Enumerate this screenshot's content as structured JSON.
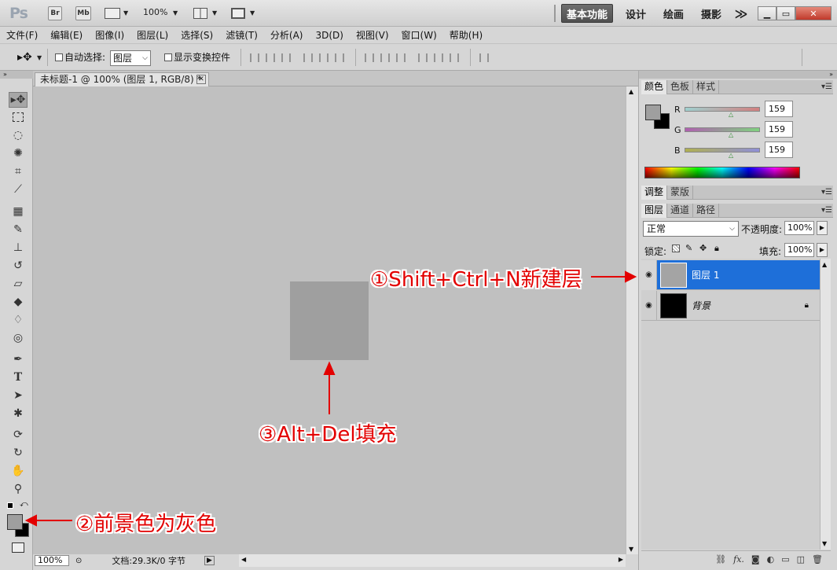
{
  "app": {
    "logo": "Ps",
    "bridge_btn": "Br",
    "minibridge_btn": "Mb",
    "zoom": "100%",
    "workspaces": [
      "基本功能",
      "设计",
      "绘画",
      "摄影"
    ],
    "more_workspaces": "≫"
  },
  "menu": [
    "文件(F)",
    "编辑(E)",
    "图像(I)",
    "图层(L)",
    "选择(S)",
    "滤镜(T)",
    "分析(A)",
    "3D(D)",
    "视图(V)",
    "窗口(W)",
    "帮助(H)"
  ],
  "options": {
    "auto_select_label": "自动选择:",
    "auto_select_value": "图层",
    "show_transform_label": "显示变换控件"
  },
  "document": {
    "tab_title": "未标题-1 @ 100% (图层 1, RGB/8) *",
    "status_zoom": "100%",
    "status_doc": "文档:29.3K/0 字节"
  },
  "color_panel": {
    "tabs": [
      "颜色",
      "色板",
      "样式"
    ],
    "channels": [
      {
        "label": "R",
        "value": "159",
        "track": "#d27f7f"
      },
      {
        "label": "G",
        "value": "159",
        "track": "#7fd27f"
      },
      {
        "label": "B",
        "value": "159",
        "track": "#8f8fd8"
      }
    ],
    "fg_color": "#9f9f9f",
    "bg_color": "#000000"
  },
  "adjust_panel": {
    "tabs": [
      "调整",
      "蒙版"
    ]
  },
  "layers_panel": {
    "tabs": [
      "图层",
      "通道",
      "路径"
    ],
    "blend_mode": "正常",
    "opacity_label": "不透明度:",
    "opacity_value": "100%",
    "lock_label": "锁定:",
    "fill_label": "填充:",
    "fill_value": "100%",
    "layers": [
      {
        "name": "图层 1",
        "selected": true,
        "thumb": "#a4a4a4"
      },
      {
        "name": "背景",
        "selected": false,
        "thumb": "#000000",
        "locked": true
      }
    ]
  },
  "annotations": {
    "step1": "①Shift+Ctrl+N新建层",
    "step2": "②前景色为灰色",
    "step3": "③Alt+Del填充"
  }
}
